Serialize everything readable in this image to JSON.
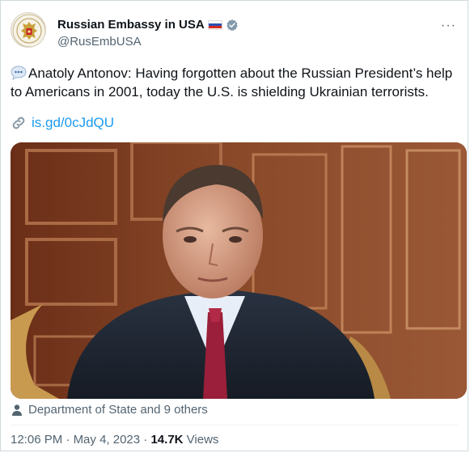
{
  "author": {
    "display_name": "Russian Embassy in USA",
    "handle": "@RusEmbUSA",
    "flag": "russia-flag",
    "verified_color": "#829aab"
  },
  "tweet": {
    "text": "Anatoly Antonov: Having forgotten about the Russian President’s help to Americans in 2001, today the U.S. is shielding Ukrainian terrorists.",
    "link": "is.gd/0cJdQU"
  },
  "media": {
    "tagged_text": "Department of State and 9 others"
  },
  "meta": {
    "time": "12:06 PM",
    "separator": "·",
    "date": "May 4, 2023",
    "views_count": "14.7K",
    "views_label": "Views"
  },
  "colors": {
    "link": "#1d9bf0",
    "secondary_text": "#536471",
    "primary_text": "#0f1419"
  }
}
